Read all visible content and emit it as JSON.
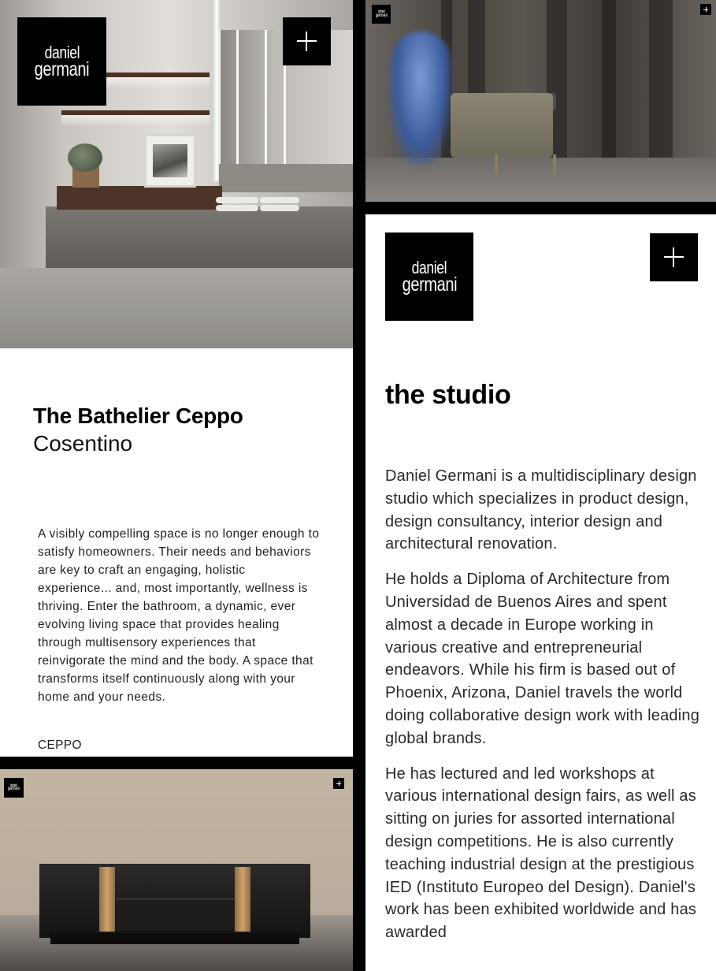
{
  "brand": {
    "logo_line1": "daniel",
    "logo_line2": "germani"
  },
  "product": {
    "title": "The Bathelier Ceppo",
    "subtitle": "Cosentino",
    "description": "A visibly compelling space is no longer enough to satisfy homeowners. Their needs and behaviors are key to craft an engaging, holistic experience... and, most importantly, wellness is thriving. Enter the bathroom, a dynamic, ever evolving living space that provides healing through multisensory experiences that reinvigorate the mind and the body. A space that transforms itself continuously along with your home and your needs.",
    "tag": "CEPPO"
  },
  "studio": {
    "title": "the studio",
    "paragraphs": [
      "Daniel Germani is a multidisciplinary design studio which specializes in product design, design consultancy, interior design and architectural renovation.",
      "He holds a Diploma of Architecture from Universidad de Buenos Aires and spent almost a decade in Europe working in various creative and entrepreneurial endeavors. While his firm is based out of Phoenix, Arizona, Daniel travels the world doing collaborative design work with leading global brands.",
      "He has lectured and led workshops at various international design fairs, as well as sitting on juries for assorted international design competitions. He is also currently teaching industrial design at the prestigious IED (Instituto Europeo del Design). Daniel's work has been exhibited worldwide and has awarded"
    ]
  },
  "icons": {
    "expand": "plus-icon"
  }
}
